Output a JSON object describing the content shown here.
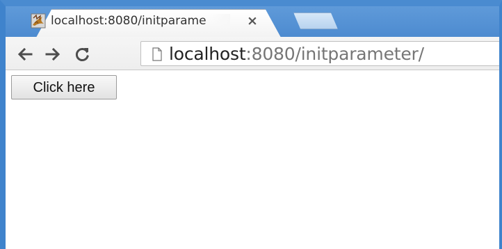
{
  "browser": {
    "tab": {
      "title": "localhost:8080/initparame",
      "favicon": "tomcat-icon",
      "close_icon": "close-icon"
    },
    "new_tab_icon": "new-tab-button",
    "toolbar": {
      "back_icon": "back-arrow-icon",
      "forward_icon": "forward-arrow-icon",
      "reload_icon": "reload-icon",
      "address": {
        "icon": "page-icon",
        "host": "localhost",
        "rest": ":8080/initparameter/"
      }
    },
    "colors": {
      "frame_blue": "#3f83cc",
      "tab_text": "#333333",
      "url_host": "#222222",
      "url_rest": "#767676"
    }
  },
  "page": {
    "button_label": "Click here"
  }
}
